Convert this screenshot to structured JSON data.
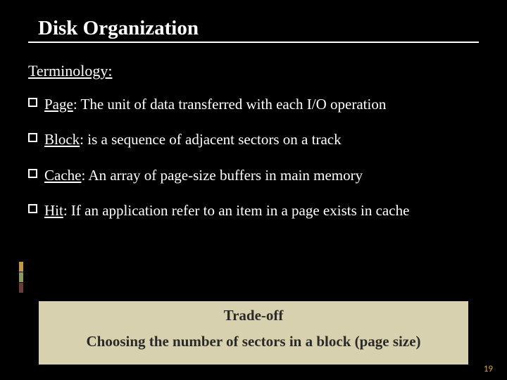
{
  "title": "Disk Organization",
  "subtitle": "Terminology:",
  "bullets": [
    {
      "term": "Page",
      "def": ": The unit of data transferred with each I/O operation"
    },
    {
      "term": "Block",
      "def": ": is a sequence of adjacent sectors on a track"
    },
    {
      "term": "Cache",
      "def": ": An array of page-size buffers in main memory"
    },
    {
      "term": "Hit",
      "def": ": If an application refer to an item in a page exists in cache"
    }
  ],
  "tradeoff": {
    "heading": "Trade-off",
    "body": "Choosing the number of sectors in a block (page size)"
  },
  "page_number": "19"
}
